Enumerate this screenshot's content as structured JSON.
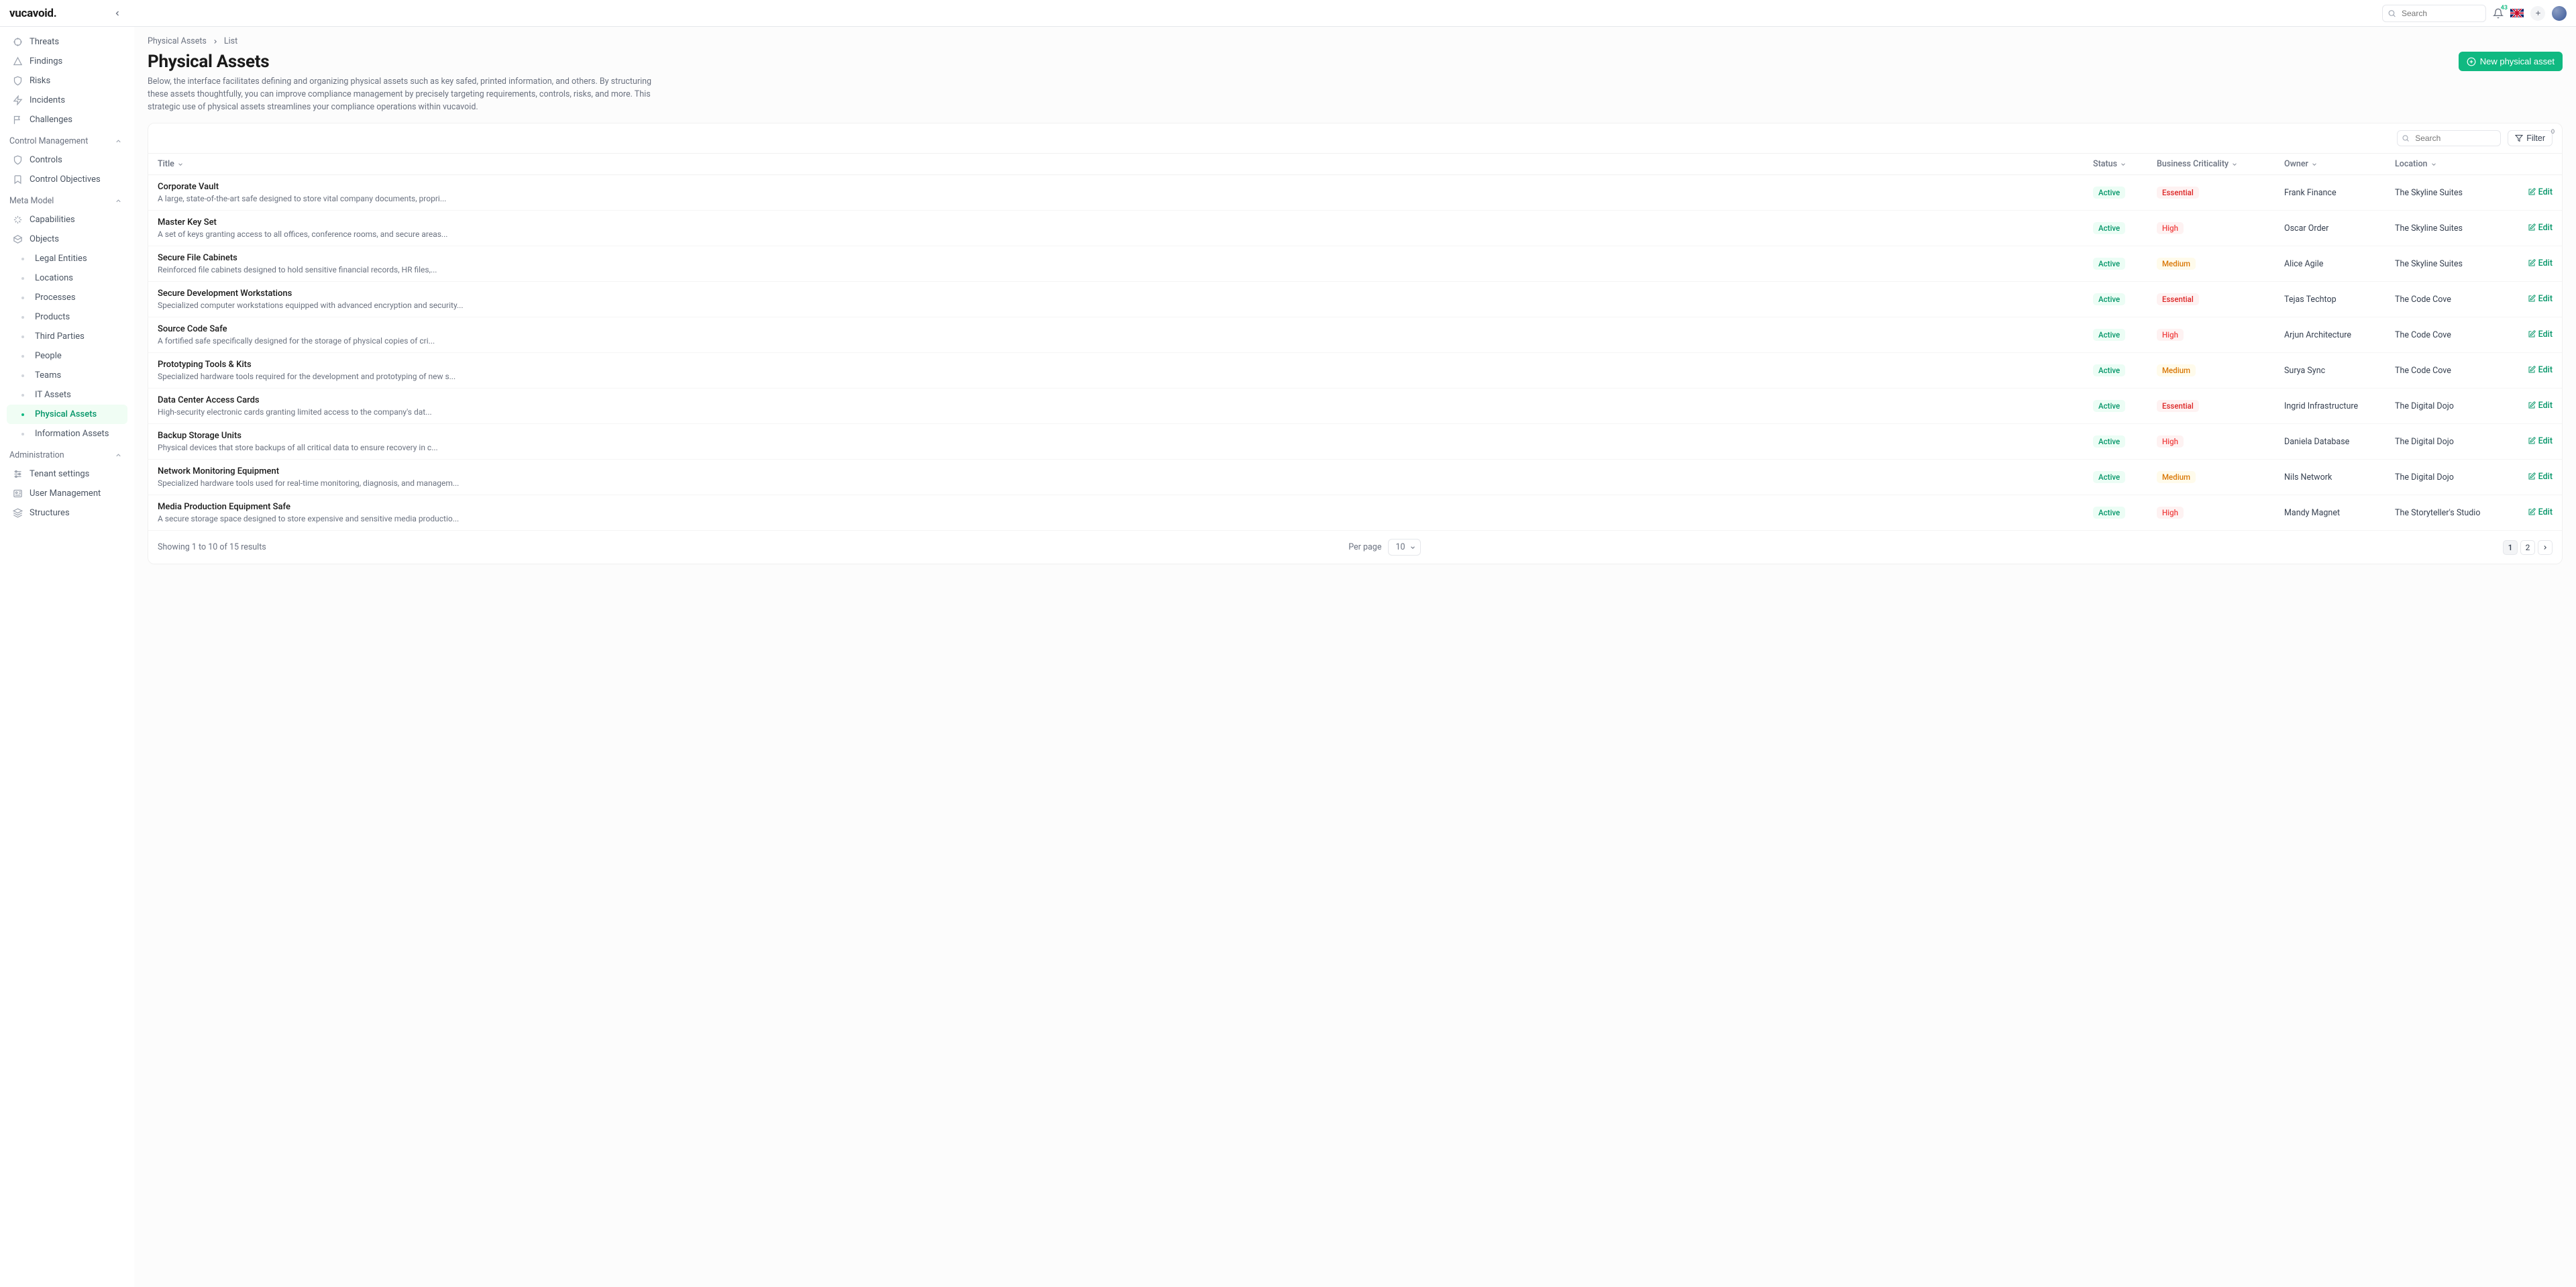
{
  "brand": "vucavoid.",
  "search": {
    "placeholder": "Search"
  },
  "notifications": {
    "count": "43"
  },
  "sidebar": {
    "top_items": [
      {
        "label": "Threats"
      },
      {
        "label": "Findings"
      },
      {
        "label": "Risks"
      },
      {
        "label": "Incidents"
      },
      {
        "label": "Challenges"
      }
    ],
    "sections": [
      {
        "title": "Control Management",
        "items": [
          {
            "label": "Controls"
          },
          {
            "label": "Control Objectives"
          }
        ]
      },
      {
        "title": "Meta Model",
        "items": [
          {
            "label": "Capabilities"
          },
          {
            "label": "Objects"
          }
        ],
        "sub_items": [
          {
            "label": "Legal Entities"
          },
          {
            "label": "Locations"
          },
          {
            "label": "Processes"
          },
          {
            "label": "Products"
          },
          {
            "label": "Third Parties"
          },
          {
            "label": "People"
          },
          {
            "label": "Teams"
          },
          {
            "label": "IT Assets"
          },
          {
            "label": "Physical Assets",
            "active": true
          },
          {
            "label": "Information Assets"
          }
        ]
      },
      {
        "title": "Administration",
        "items": [
          {
            "label": "Tenant settings"
          },
          {
            "label": "User Management"
          },
          {
            "label": "Structures"
          }
        ]
      }
    ]
  },
  "breadcrumb": [
    {
      "label": "Physical Assets"
    },
    {
      "label": "List"
    }
  ],
  "page": {
    "title": "Physical Assets",
    "description": "Below, the interface facilitates defining and organizing physical assets such as key safed, printed information, and others. By structuring these assets thoughtfully, you can improve compliance management by precisely targeting requirements, controls, risks, and more. This strategic use of physical assets streamlines your compliance operations within vucavoid.",
    "new_button": "New physical asset"
  },
  "table": {
    "search_placeholder": "Search",
    "filter_label": "Filter",
    "filter_count": "0",
    "columns": {
      "title": "Title",
      "status": "Status",
      "criticality": "Business Criticality",
      "owner": "Owner",
      "location": "Location"
    },
    "edit_label": "Edit",
    "rows": [
      {
        "title": "Corporate Vault",
        "desc": "A large, state-of-the-art safe designed to store vital company documents, propri...",
        "status": "Active",
        "criticality": "Essential",
        "owner": "Frank Finance",
        "location": "The Skyline Suites"
      },
      {
        "title": "Master Key Set",
        "desc": "A set of keys granting access to all offices, conference rooms, and secure areas...",
        "status": "Active",
        "criticality": "High",
        "owner": "Oscar Order",
        "location": "The Skyline Suites"
      },
      {
        "title": "Secure File Cabinets",
        "desc": "Reinforced file cabinets designed to hold sensitive financial records, HR files,...",
        "status": "Active",
        "criticality": "Medium",
        "owner": "Alice Agile",
        "location": "The Skyline Suites"
      },
      {
        "title": "Secure Development Workstations",
        "desc": "Specialized computer workstations equipped with advanced encryption and security...",
        "status": "Active",
        "criticality": "Essential",
        "owner": "Tejas Techtop",
        "location": "The Code Cove"
      },
      {
        "title": "Source Code Safe",
        "desc": "A fortified safe specifically designed for the storage of physical copies of cri...",
        "status": "Active",
        "criticality": "High",
        "owner": "Arjun Architecture",
        "location": "The Code Cove"
      },
      {
        "title": "Prototyping Tools & Kits",
        "desc": "Specialized hardware tools required for the development and prototyping of new s...",
        "status": "Active",
        "criticality": "Medium",
        "owner": "Surya Sync",
        "location": "The Code Cove"
      },
      {
        "title": "Data Center Access Cards",
        "desc": "High-security electronic cards granting limited access to the company's dat...",
        "status": "Active",
        "criticality": "Essential",
        "owner": "Ingrid Infrastructure",
        "location": "The Digital Dojo"
      },
      {
        "title": "Backup Storage Units",
        "desc": "Physical devices that store backups of all critical data to ensure recovery in c...",
        "status": "Active",
        "criticality": "High",
        "owner": "Daniela Database",
        "location": "The Digital Dojo"
      },
      {
        "title": "Network Monitoring Equipment",
        "desc": "Specialized hardware tools used for real-time monitoring, diagnosis, and managem...",
        "status": "Active",
        "criticality": "Medium",
        "owner": "Nils Network",
        "location": "The Digital Dojo"
      },
      {
        "title": "Media Production Equipment Safe",
        "desc": "A secure storage space designed to store expensive and sensitive media productio...",
        "status": "Active",
        "criticality": "High",
        "owner": "Mandy Magnet",
        "location": "The Storyteller's Studio"
      }
    ],
    "footer": {
      "results": "Showing 1 to 10 of 15 results",
      "per_page_label": "Per page",
      "per_page_value": "10",
      "pages": [
        "1",
        "2"
      ],
      "active_page": "1"
    }
  }
}
